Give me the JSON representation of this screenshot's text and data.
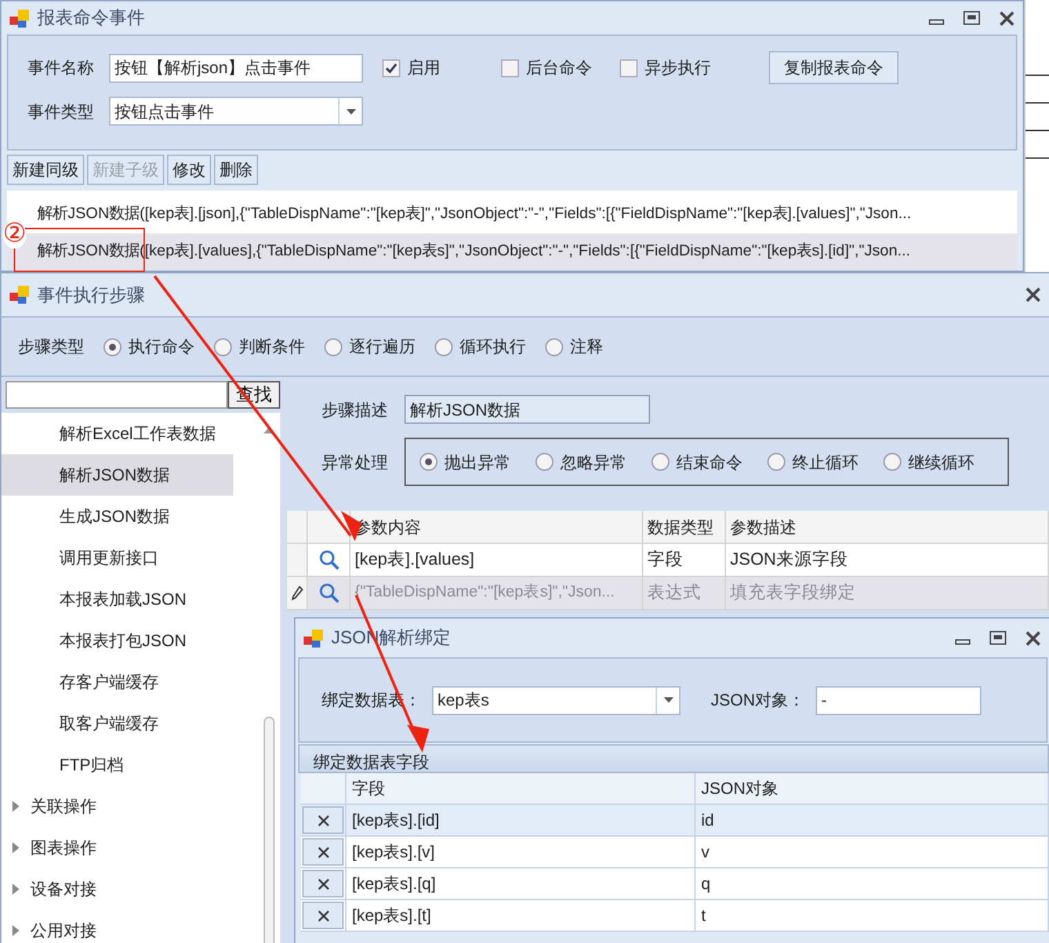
{
  "event_window": {
    "title": "报表命令事件",
    "name_field": {
      "label": "事件名称",
      "value": "按钮【解析json】点击事件"
    },
    "type_field": {
      "label": "事件类型",
      "value": "按钮点击事件"
    },
    "checkboxes": [
      {
        "label": "启用",
        "checked": true
      },
      {
        "label": "后台命令",
        "checked": false
      },
      {
        "label": "异步执行",
        "checked": false
      }
    ],
    "copy_button": "复制报表命令",
    "toolbar": [
      {
        "label": "新建同级",
        "disabled": false
      },
      {
        "label": "新建子级",
        "disabled": true
      },
      {
        "label": "修改",
        "disabled": false
      },
      {
        "label": "删除",
        "disabled": false
      }
    ],
    "commands": [
      {
        "text": "解析JSON数据([kep表].[json],{\"TableDispName\":\"[kep表]\",\"JsonObject\":\"-\",\"Fields\":[{\"FieldDispName\":\"[kep表].[values]\",\"Json...",
        "selected": false
      },
      {
        "text": "解析JSON数据([kep表].[values],{\"TableDispName\":\"[kep表s]\",\"JsonObject\":\"-\",\"Fields\":[{\"FieldDispName\":\"[kep表s].[id]\",\"Json...",
        "selected": true
      }
    ]
  },
  "step_window": {
    "title": "事件执行步骤",
    "step_type": {
      "label": "步骤类型",
      "options": [
        {
          "label": "执行命令",
          "selected": true
        },
        {
          "label": "判断条件",
          "selected": false
        },
        {
          "label": "逐行遍历",
          "selected": false
        },
        {
          "label": "循环执行",
          "selected": false
        },
        {
          "label": "注释",
          "selected": false
        }
      ]
    },
    "search_button": "查找",
    "tree": {
      "children": [
        {
          "label": "解析Excel工作表数据",
          "selected": false
        },
        {
          "label": "解析JSON数据",
          "selected": true
        },
        {
          "label": "生成JSON数据",
          "selected": false
        },
        {
          "label": "调用更新接口",
          "selected": false
        },
        {
          "label": "本报表加载JSON",
          "selected": false
        },
        {
          "label": "本报表打包JSON",
          "selected": false
        },
        {
          "label": "存客户端缓存",
          "selected": false
        },
        {
          "label": "取客户端缓存",
          "selected": false
        },
        {
          "label": "FTP归档",
          "selected": false
        }
      ],
      "groups": [
        {
          "label": "关联操作",
          "expanded": false
        },
        {
          "label": "图表操作",
          "expanded": false
        },
        {
          "label": "设备对接",
          "expanded": false
        },
        {
          "label": "公用对接",
          "expanded": false
        }
      ]
    },
    "description": {
      "label": "步骤描述",
      "value": "解析JSON数据"
    },
    "exception": {
      "label": "异常处理",
      "options": [
        {
          "label": "抛出异常",
          "selected": true
        },
        {
          "label": "忽略异常",
          "selected": false
        },
        {
          "label": "结束命令",
          "selected": false
        },
        {
          "label": "终止循环",
          "selected": false
        },
        {
          "label": "继续循环",
          "selected": false
        }
      ]
    },
    "params": {
      "columns": [
        "参数内容",
        "数据类型",
        "参数描述"
      ],
      "rows": [
        {
          "content": "[kep表].[values]",
          "type": "字段",
          "description": "JSON来源字段",
          "editing": false
        },
        {
          "content": "{\"TableDispName\":\"[kep表s]\",\"Json...",
          "type": "表达式",
          "description": "填充表字段绑定",
          "editing": true
        }
      ]
    }
  },
  "binding_window": {
    "title": "JSON解析绑定",
    "table_field": {
      "label": "绑定数据表：",
      "value": "kep表s"
    },
    "json_object": {
      "label": "JSON对象：",
      "value": "-"
    },
    "group_title": "绑定数据表字段",
    "columns": [
      "字段",
      "JSON对象"
    ],
    "rows": [
      {
        "field": "[kep表s].[id]",
        "json": "id",
        "selected": true
      },
      {
        "field": "[kep表s].[v]",
        "json": "v",
        "selected": false
      },
      {
        "field": "[kep表s].[q]",
        "json": "q",
        "selected": false
      },
      {
        "field": "[kep表s].[t]",
        "json": "t",
        "selected": false
      }
    ]
  },
  "annotation": {
    "marker": "②"
  }
}
